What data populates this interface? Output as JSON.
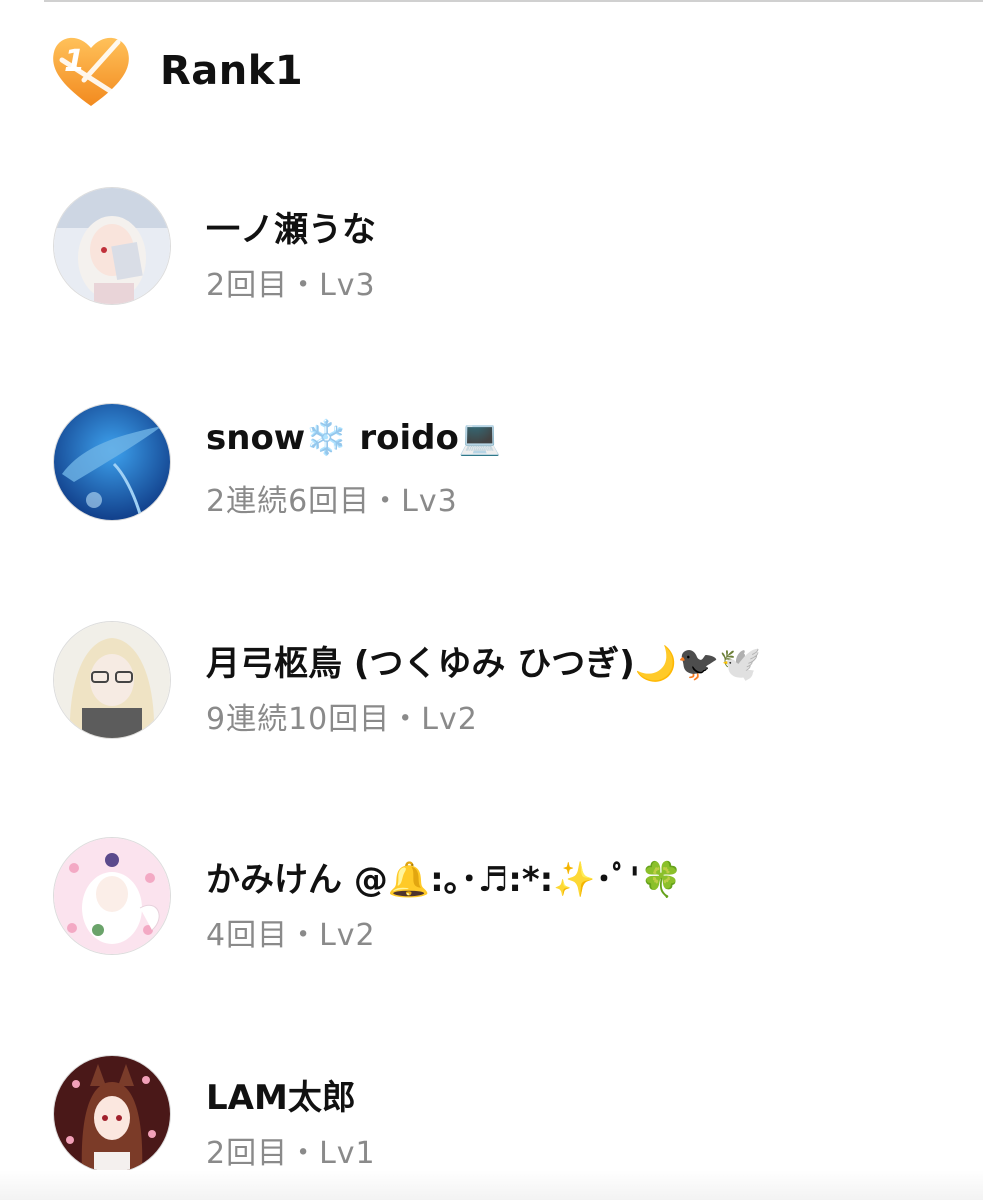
{
  "header": {
    "rank_number": "1",
    "title": "Rank1",
    "accent_color": "#f7a23a"
  },
  "rows": [
    {
      "name": "一ノ瀬うな",
      "meta": "2回目・Lv3",
      "avatar_colors": [
        "#e9ecf3",
        "#cfd6e2"
      ]
    },
    {
      "name": "snow❄️ roido💻",
      "meta": "2連続6回目・Lv3",
      "avatar_colors": [
        "#0f3e8a",
        "#2b8ad8"
      ]
    },
    {
      "name": "月弓柩鳥 (つくゆみ ひつぎ)🌙🐦‍⬛🕊️",
      "meta": "9連続10回目・Lv2",
      "avatar_colors": [
        "#f1efe8",
        "#9a9a98"
      ]
    },
    {
      "name": "かみけん @🔔:｡･♬:*:✨･ﾟ'🍀",
      "meta": "4回目・Lv2",
      "avatar_colors": [
        "#fbe3ee",
        "#f3c7db"
      ]
    },
    {
      "name": "LAM太郎",
      "meta": "2回目・Lv1",
      "avatar_colors": [
        "#3a1313",
        "#8a3535"
      ]
    }
  ]
}
